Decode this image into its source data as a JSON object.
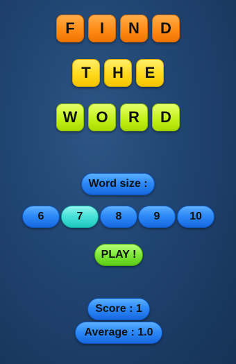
{
  "title": {
    "rows": [
      {
        "word": [
          "F",
          "I",
          "N",
          "D"
        ],
        "color": "#ff8c16"
      },
      {
        "word": [
          "T",
          "H",
          "E"
        ],
        "color": "#ffd91c"
      },
      {
        "word": [
          "W",
          "O",
          "R",
          "D"
        ],
        "color": "#c4f21c"
      }
    ]
  },
  "word_size": {
    "label": "Word size :",
    "options": [
      "6",
      "7",
      "8",
      "9",
      "10"
    ],
    "selected": "7"
  },
  "play_label": "PLAY !",
  "stats": {
    "score_label": "Score : 1",
    "average_label": "Average : 1.0"
  }
}
